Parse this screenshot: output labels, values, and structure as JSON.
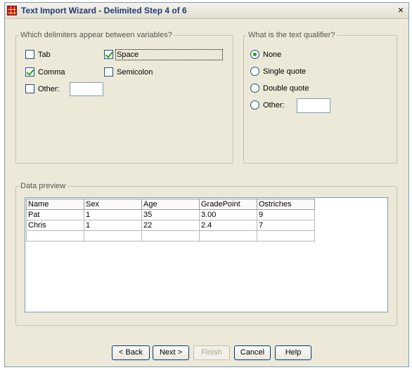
{
  "window": {
    "title": "Text Import Wizard - Delimited Step 4 of 6",
    "close_glyph": "×"
  },
  "delimiters": {
    "legend": "Which delimiters appear between variables?",
    "tab": {
      "label": "Tab",
      "checked": false
    },
    "space": {
      "label": "Space",
      "checked": true
    },
    "comma": {
      "label": "Comma",
      "checked": true
    },
    "semicolon": {
      "label": "Semicolon",
      "checked": false
    },
    "other": {
      "label": "Other:",
      "checked": false,
      "value": ""
    }
  },
  "qualifier": {
    "legend": "What is the text qualifier?",
    "none": {
      "label": "None",
      "selected": true
    },
    "single_quote": {
      "label": "Single quote",
      "selected": false
    },
    "double_quote": {
      "label": "Double quote",
      "selected": false
    },
    "other": {
      "label": "Other:",
      "selected": false,
      "value": ""
    }
  },
  "preview": {
    "legend": "Data preview",
    "columns": [
      "Name",
      "Sex",
      "Age",
      "GradePoint",
      "Ostriches"
    ],
    "rows": [
      [
        "Pat",
        "1",
        "35",
        "3.00",
        "9"
      ],
      [
        "Chris",
        "1",
        "22",
        "2.4",
        "7"
      ],
      [
        "",
        "",
        "",
        "",
        ""
      ]
    ]
  },
  "buttons": {
    "back": "< Back",
    "next": "Next >",
    "finish": "Finish",
    "cancel": "Cancel",
    "help": "Help"
  },
  "colors": {
    "accent": "#1c3a78",
    "check": "#21a121",
    "dialog_bg": "#ece9d8"
  }
}
